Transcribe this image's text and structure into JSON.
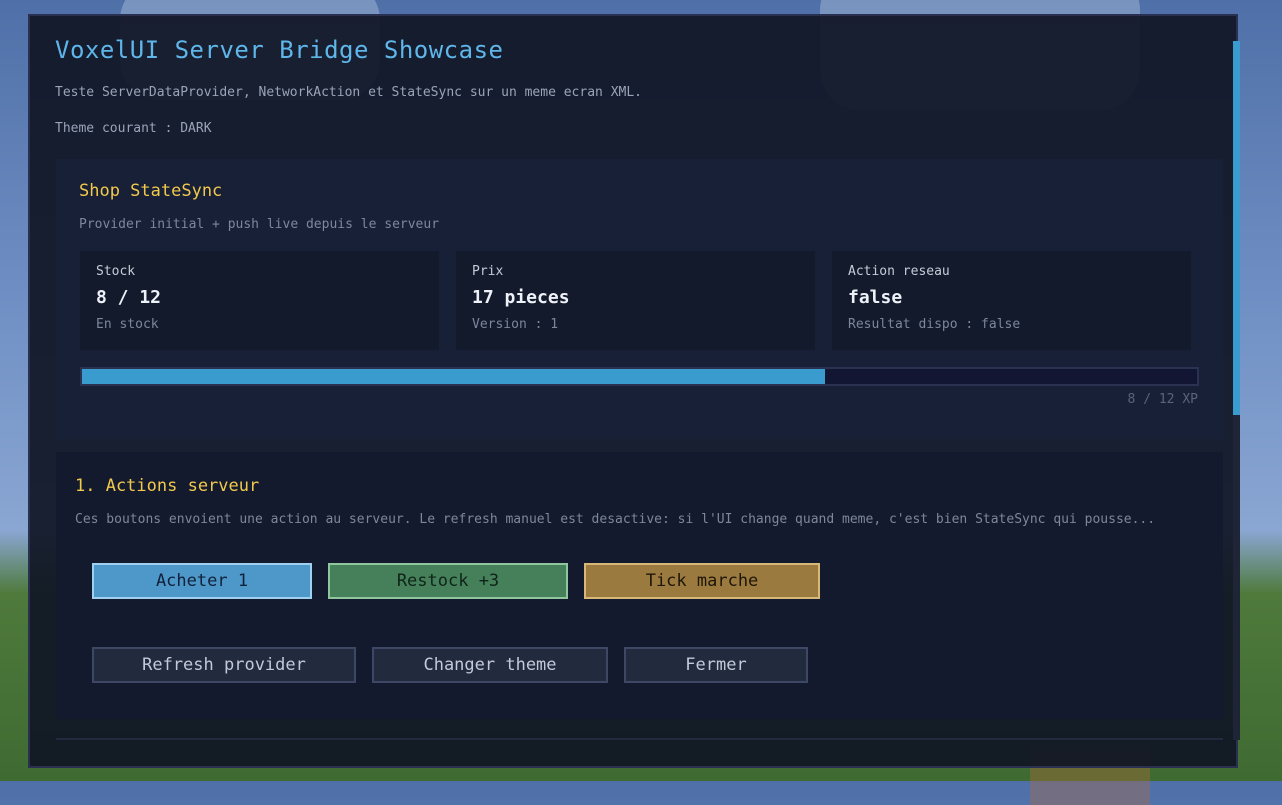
{
  "header": {
    "title": "VoxelUI Server Bridge Showcase",
    "subtitle": "Teste ServerDataProvider, NetworkAction et StateSync sur un meme ecran XML.",
    "theme_line": "Theme courant : DARK"
  },
  "shop": {
    "title": "Shop StateSync",
    "subtitle": "Provider initial + push live depuis le serveur",
    "stats": [
      {
        "label": "Stock",
        "value": "8 / 12",
        "note": "En stock"
      },
      {
        "label": "Prix",
        "value": "17 pieces",
        "note": "Version : 1"
      },
      {
        "label": "Action reseau",
        "value": "false",
        "note": "Resultat dispo : false"
      }
    ],
    "progress": {
      "current": 8,
      "max": 12,
      "label": "8 / 12 XP"
    }
  },
  "actions": {
    "title": "1. Actions serveur",
    "description": "Ces boutons envoient une action au serveur. Le refresh manuel est desactive: si l'UI change quand meme, c'est bien StateSync qui pousse...",
    "primary_buttons": [
      {
        "label": "Acheter 1"
      },
      {
        "label": "Restock +3"
      },
      {
        "label": "Tick marche"
      }
    ],
    "secondary_buttons": [
      {
        "label": "Refresh provider"
      },
      {
        "label": "Changer theme"
      },
      {
        "label": "Fermer"
      }
    ]
  },
  "colors": {
    "accent": "#3a9bcf",
    "heading": "#f2c94c",
    "panel": "#101525"
  }
}
